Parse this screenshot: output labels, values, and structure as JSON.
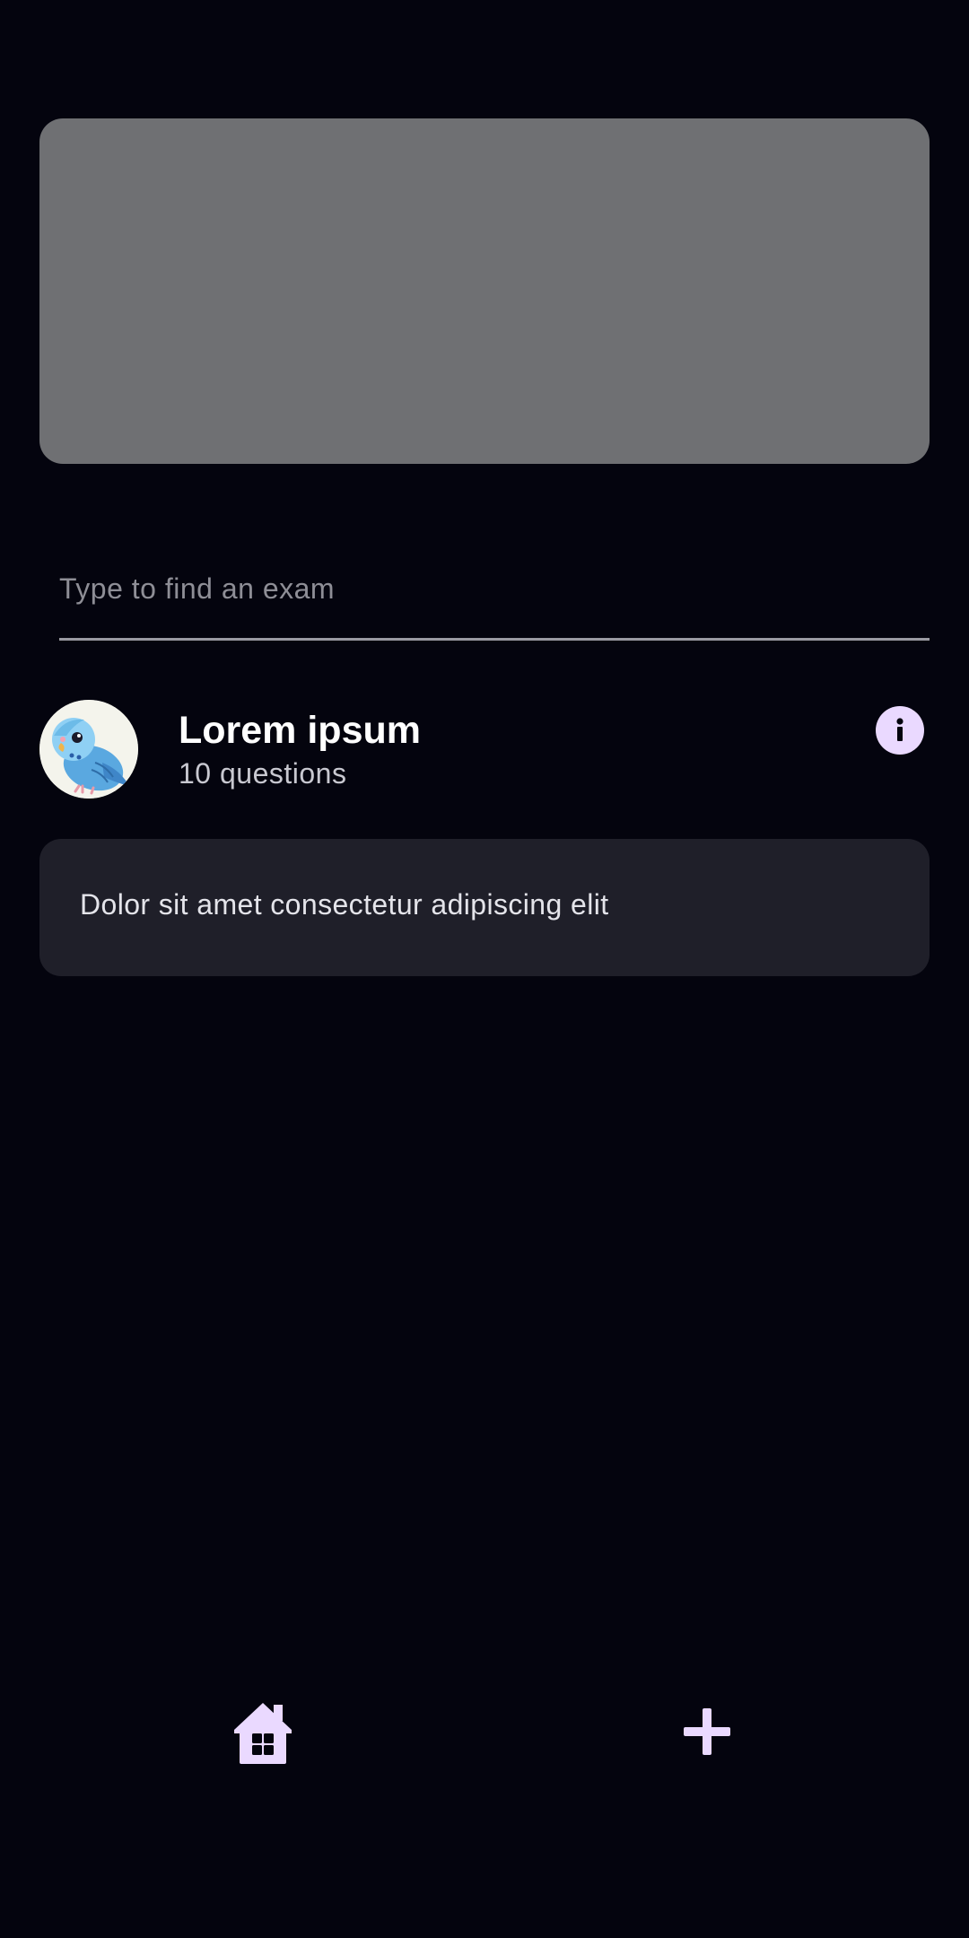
{
  "search": {
    "placeholder": "Type to find an exam",
    "value": ""
  },
  "exam": {
    "title": "Lorem ipsum",
    "subtitle": "10 questions",
    "description": "Dolor sit amet consectetur adipiscing elit",
    "avatar_icon": "budgie-bird-avatar"
  },
  "icons": {
    "info": "info-icon",
    "home": "home-icon",
    "add": "plus-icon"
  },
  "colors": {
    "background": "#04040e",
    "banner": "#6f7073",
    "card": "#1f1f29",
    "accent": "#ead9ff"
  }
}
